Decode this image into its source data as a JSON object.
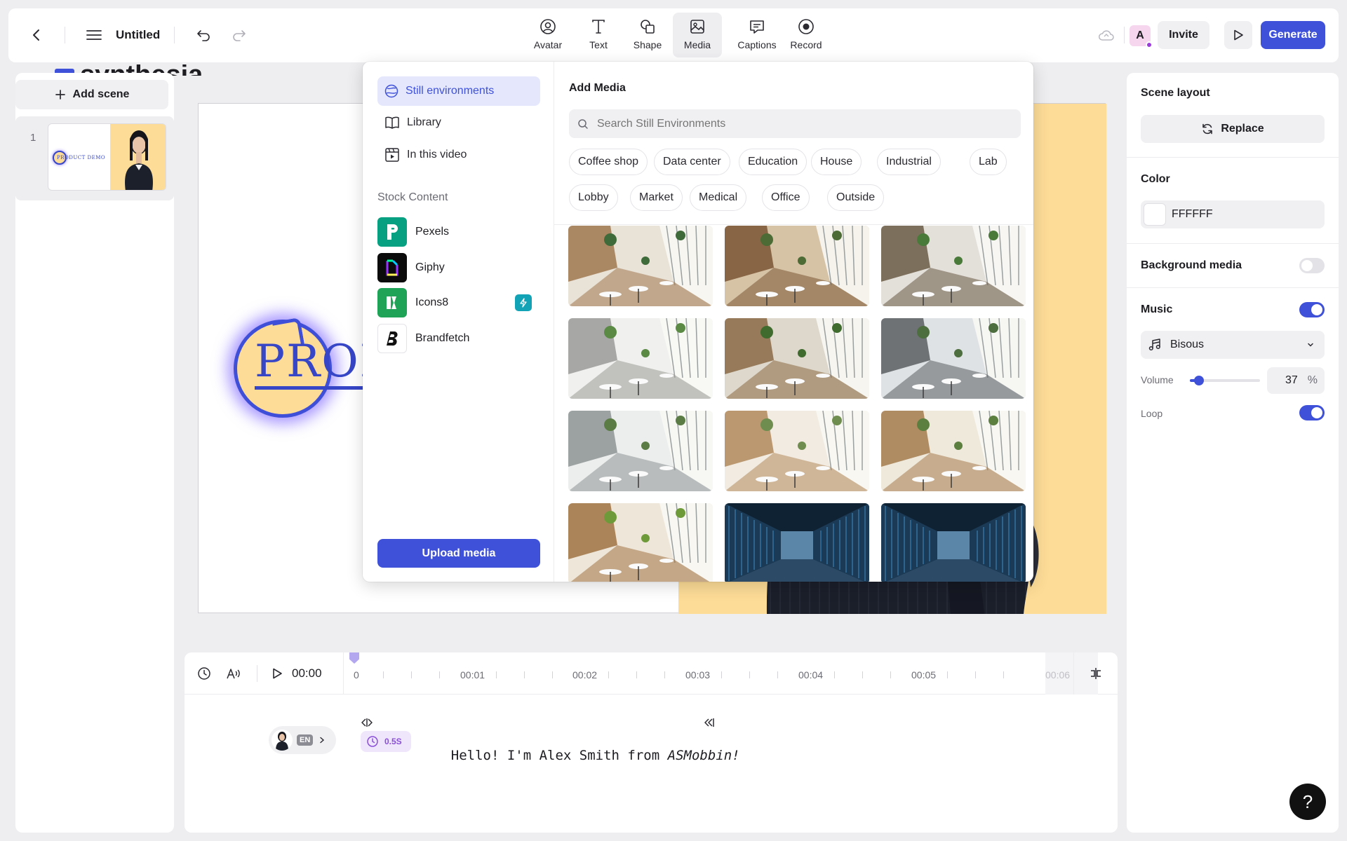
{
  "header": {
    "doc_title": "Untitled",
    "tools": [
      {
        "label": "Avatar",
        "icon": "avatar-icon"
      },
      {
        "label": "Text",
        "icon": "text-icon"
      },
      {
        "label": "Shape",
        "icon": "shape-icon"
      },
      {
        "label": "Media",
        "icon": "media-icon"
      },
      {
        "label": "Captions",
        "icon": "captions-icon"
      },
      {
        "label": "Record",
        "icon": "record-icon"
      }
    ],
    "active_tool": "Media",
    "user_initial": "A",
    "invite_label": "Invite",
    "generate_label": "Generate"
  },
  "brand_text": "synthesia",
  "scenes": {
    "add_label": "Add scene",
    "items": [
      {
        "number": "1",
        "logo_text": "PRODUCT DEMO"
      }
    ]
  },
  "canvas": {
    "logo_text": "PROD"
  },
  "media_popup": {
    "nav": [
      {
        "label": "Still environments",
        "icon": "globe-icon",
        "active": true
      },
      {
        "label": "Library",
        "icon": "book-icon"
      },
      {
        "label": "In this video",
        "icon": "film-icon"
      }
    ],
    "stock_heading": "Stock Content",
    "stock": [
      {
        "name": "Pexels",
        "icon": "pexels-logo-icon"
      },
      {
        "name": "Giphy",
        "icon": "giphy-logo-icon"
      },
      {
        "name": "Icons8",
        "icon": "icons8-logo-icon",
        "badge": "lightning-icon"
      },
      {
        "name": "Brandfetch",
        "icon": "brandfetch-logo-icon"
      }
    ],
    "upload_label": "Upload media",
    "title": "Add Media",
    "search_placeholder": "Search Still Environments",
    "chips_row1": [
      "Coffee shop",
      "Data center",
      "Education",
      "House",
      "Industrial",
      "Lab"
    ],
    "chips_row2": [
      "Lobby",
      "Market",
      "Medical",
      "Office",
      "Outside"
    ],
    "thumbnails": [
      "cafe",
      "cafe",
      "cafe",
      "cafe",
      "cafe",
      "cafe",
      "cafe",
      "cafe",
      "cafe",
      "cafe",
      "server-room",
      "server-room"
    ]
  },
  "properties": {
    "scene_layout_label": "Scene layout",
    "replace_label": "Replace",
    "color_label": "Color",
    "color_value": "FFFFFF",
    "background_media_label": "Background media",
    "background_media_on": false,
    "music_label": "Music",
    "music_on": true,
    "music_track": "Bisous",
    "volume_label": "Volume",
    "volume_value": "37",
    "volume_unit": "%",
    "loop_label": "Loop",
    "loop_on": true
  },
  "timeline": {
    "current_time": "00:00",
    "marks": [
      "0",
      "00:01",
      "00:02",
      "00:03",
      "00:04",
      "00:05",
      "00:06"
    ],
    "script_lang": "EN",
    "pause_label": "0.5S",
    "script_text": "Hello! I'm Alex Smith from ",
    "script_emph": "ASMobbin!"
  },
  "help_label": "?",
  "colors": {
    "accent": "#3f51d8",
    "accent_light": "#e5e8fc",
    "canvas_bg": "#fddc97",
    "logo_blue": "#3646c7"
  }
}
